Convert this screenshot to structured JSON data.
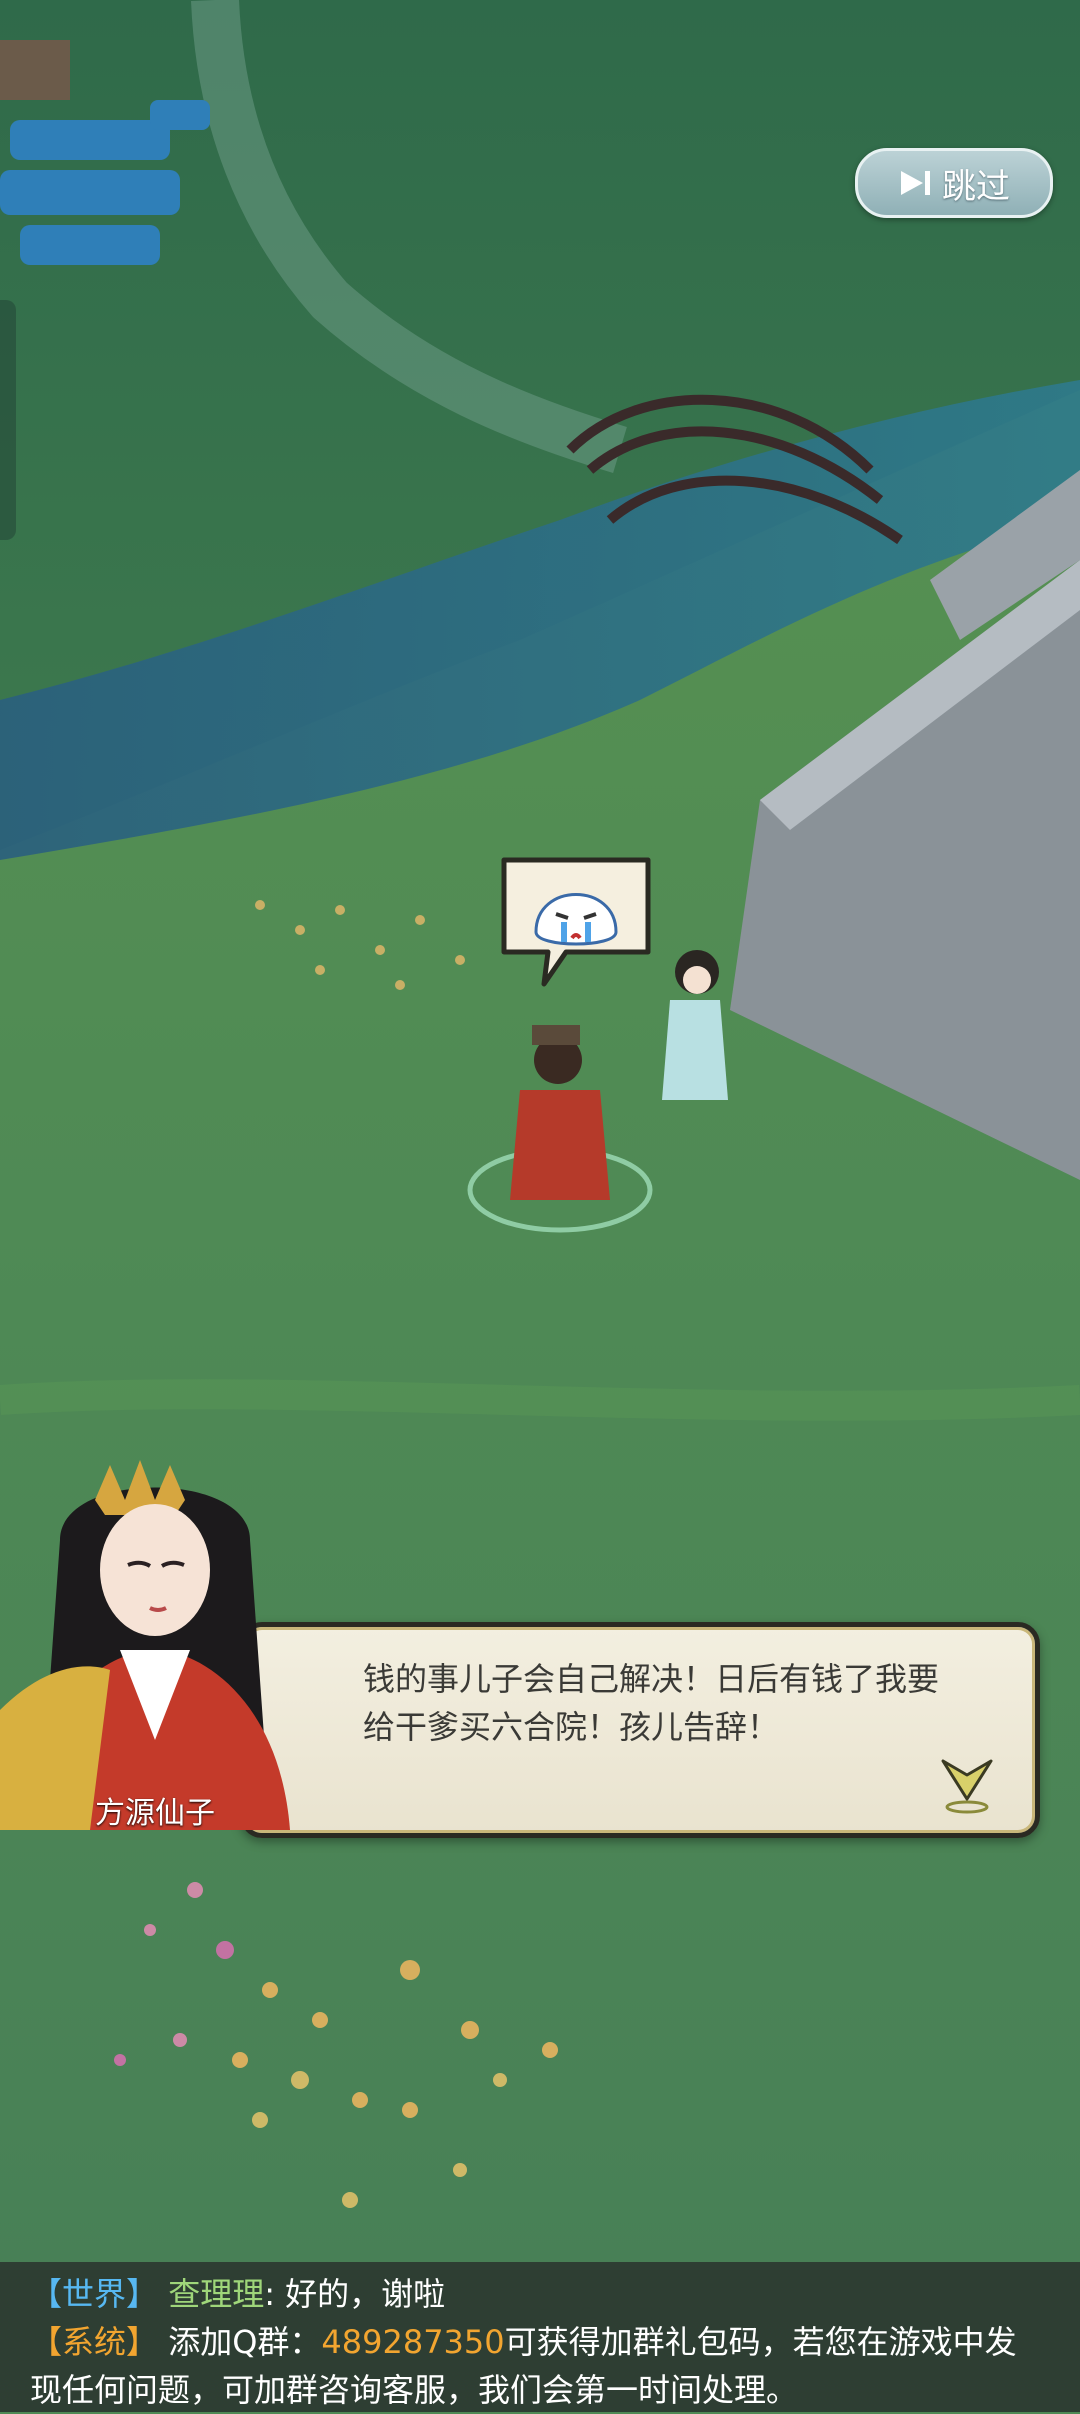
{
  "skip_button": {
    "label": "跳过",
    "icon": "play-skip-icon"
  },
  "dialog": {
    "speaker": "方源仙子",
    "text_line1": "钱的事儿子会自己解决！日后有钱了我要",
    "text_line2": "给干爹买六合院！孩儿告辞！",
    "next_icon": "chevron-down-icon"
  },
  "emote": {
    "icon": "crying-face-icon"
  },
  "chat": {
    "world": {
      "channel": "【世界】",
      "sender": "查理理",
      "separator": ": ",
      "message": "好的，谢啦"
    },
    "system": {
      "channel": "【系统】",
      "prefix": "添加Q群：",
      "qq_number": "489287350",
      "suffix": "可获得加群礼包码，若您在游戏中发",
      "line2": "现任何问题，可加群咨询客服，我们会第一时间处理。"
    }
  },
  "colors": {
    "world_tag": "#57b8f2",
    "system_tag": "#f2a530",
    "sender": "#9fd67a",
    "grass": "#4f8a55",
    "river": "#2e6b8a"
  }
}
